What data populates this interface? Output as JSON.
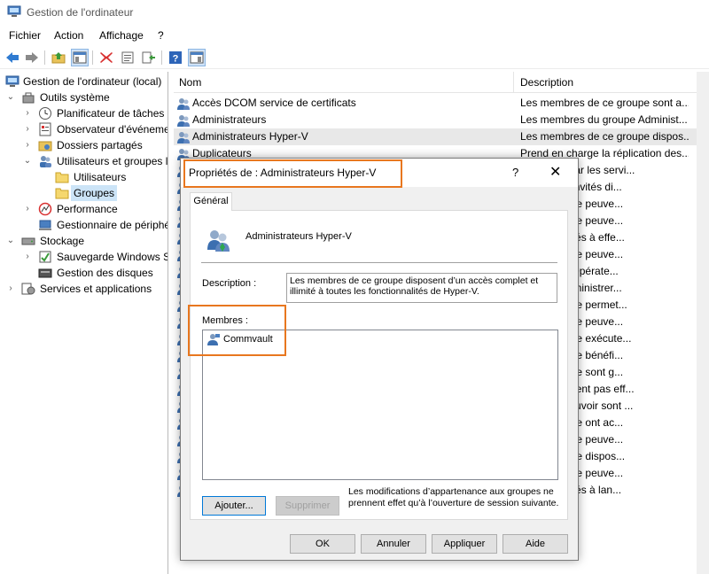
{
  "window": {
    "title": "Gestion de l'ordinateur"
  },
  "menu": [
    "Fichier",
    "Action",
    "Affichage",
    "?"
  ],
  "toolbar": {
    "icons": [
      "back-arrow-icon",
      "forward-arrow-icon",
      "up-folder-icon",
      "show-hide-tree-icon",
      "delete-icon",
      "properties-icon",
      "export-list-icon",
      "help-icon",
      "show-hide-action-pane-icon"
    ]
  },
  "tree": [
    {
      "label": "Gestion de l'ordinateur (local)",
      "icon": "computer-management-icon"
    },
    {
      "label": "Outils système",
      "icon": "system-tools-icon"
    },
    {
      "label": "Planificateur de tâches",
      "icon": "task-scheduler-icon"
    },
    {
      "label": "Observateur d'événeme",
      "icon": "event-viewer-icon"
    },
    {
      "label": "Dossiers partagés",
      "icon": "shared-folders-icon"
    },
    {
      "label": "Utilisateurs et groupes l",
      "icon": "users-groups-icon"
    },
    {
      "label": "Utilisateurs",
      "icon": "folder-icon"
    },
    {
      "label": "Groupes",
      "icon": "folder-icon"
    },
    {
      "label": "Performance",
      "icon": "performance-icon"
    },
    {
      "label": "Gestionnaire de périphé",
      "icon": "device-manager-icon"
    },
    {
      "label": "Stockage",
      "icon": "storage-icon"
    },
    {
      "label": "Sauvegarde Windows Se",
      "icon": "windows-backup-icon"
    },
    {
      "label": "Gestion des disques",
      "icon": "disk-management-icon"
    },
    {
      "label": "Services et applications",
      "icon": "services-applications-icon"
    }
  ],
  "list": {
    "columns": {
      "name": "Nom",
      "description": "Description"
    },
    "rows": [
      {
        "name": "Accès DCOM service de certificats",
        "desc": "Les membres de ce groupe sont a..."
      },
      {
        "name": "Administrateurs",
        "desc": "Les membres du groupe Administ..."
      },
      {
        "name": "Administrateurs Hyper-V",
        "desc": "Les membres de ce groupe dispos..."
      },
      {
        "name": "Duplicateurs",
        "desc": "Prend en charge la réplication des..."
      },
      {
        "name": "",
        "desc": "gré utilisé par les servi..."
      },
      {
        "name": "",
        "desc": "du groupe Invités di..."
      },
      {
        "name": "",
        "desc": "de ce groupe peuve..."
      },
      {
        "name": "",
        "desc": "de ce groupe peuve..."
      },
      {
        "name": "",
        "desc": "sont autorisés à effe..."
      },
      {
        "name": "",
        "desc": "de ce groupe peuve..."
      },
      {
        "name": "",
        "desc": "du groupe Opérate..."
      },
      {
        "name": "",
        "desc": "peuvent administrer..."
      },
      {
        "name": "",
        "desc": "de ce groupe permet..."
      },
      {
        "name": "",
        "desc": "de ce groupe peuve..."
      },
      {
        "name": "",
        "desc": "de ce groupe exécute..."
      },
      {
        "name": "",
        "desc": "de ce groupe bénéfi..."
      },
      {
        "name": "",
        "desc": "de ce groupe sont g..."
      },
      {
        "name": "",
        "desc": "urs ne peuvent pas eff..."
      },
      {
        "name": "",
        "desc": "urs avec pouvoir sont ..."
      },
      {
        "name": "",
        "desc": "de ce groupe ont ac..."
      },
      {
        "name": "",
        "desc": "de ce groupe peuve..."
      },
      {
        "name": "",
        "desc": "de ce groupe dispos..."
      },
      {
        "name": "",
        "desc": "de ce groupe peuve..."
      },
      {
        "name": "",
        "desc": "sont autorisés à lan..."
      }
    ]
  },
  "dialog": {
    "title": "Propriétés de : Administrateurs Hyper-V",
    "help": "?",
    "close": "✕",
    "tab": "Général",
    "group_name": "Administrateurs Hyper-V",
    "description_label": "Description :",
    "description": "Les membres de ce groupe disposent d’un accès complet et illimité à toutes les fonctionnalités de Hyper-V.",
    "members_label": "Membres :",
    "members": [
      "Commvault"
    ],
    "add_button": "Ajouter...",
    "remove_button": "Supprimer",
    "note": "Les modifications d’appartenance aux groupes ne prennent effet qu’à l’ouverture de session suivante.",
    "ok": "OK",
    "cancel": "Annuler",
    "apply": "Appliquer",
    "help_button": "Aide"
  },
  "colors": {
    "highlight": "#e8771f",
    "selection": "#cce4f7"
  }
}
